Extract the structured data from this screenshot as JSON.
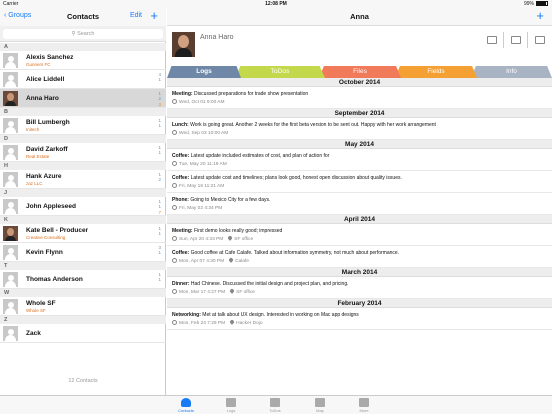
{
  "status": {
    "carrier": "Carrier",
    "time": "12:08 PM",
    "battery": "99%"
  },
  "left": {
    "back_label": "Groups",
    "title": "Contacts",
    "edit_label": "Edit",
    "add_label": "+",
    "search_placeholder": "Search",
    "footer": "12 Contacts",
    "sections": [
      {
        "letter": "A",
        "contacts": [
          {
            "name": "Alexis Sanchez",
            "company": "Gunners FC",
            "avatar": "generic",
            "counts": []
          },
          {
            "name": "Alice Liddell",
            "company": "",
            "avatar": "generic",
            "counts": [
              "4",
              "1"
            ]
          },
          {
            "name": "Anna Haro",
            "company": "",
            "avatar": "photo",
            "counts": [
              "1",
              "2",
              "3"
            ],
            "selected": true
          }
        ]
      },
      {
        "letter": "B",
        "contacts": [
          {
            "name": "Bill Lumbergh",
            "company": "Initech",
            "avatar": "generic",
            "counts": [
              "1",
              "1"
            ]
          }
        ]
      },
      {
        "letter": "D",
        "contacts": [
          {
            "name": "David Zarkoff",
            "company": "Real Estate",
            "avatar": "generic",
            "counts": [
              "1",
              "1"
            ]
          }
        ]
      },
      {
        "letter": "H",
        "contacts": [
          {
            "name": "Hank Azure",
            "company": "zaz LLC",
            "avatar": "generic",
            "counts": [
              "1",
              "2"
            ]
          }
        ]
      },
      {
        "letter": "J",
        "contacts": [
          {
            "name": "John Appleseed",
            "company": "",
            "avatar": "generic",
            "counts": [
              "1",
              "1",
              "7"
            ]
          }
        ]
      },
      {
        "letter": "K",
        "contacts": [
          {
            "name": "Kate Bell - Producer",
            "company": "Creative Consulting",
            "avatar": "photo",
            "counts": [
              "1",
              "1"
            ]
          },
          {
            "name": "Kevin Flynn",
            "company": "",
            "avatar": "generic",
            "counts": [
              "3",
              "1"
            ]
          }
        ]
      },
      {
        "letter": "T",
        "contacts": [
          {
            "name": "Thomas Anderson",
            "company": "",
            "avatar": "generic",
            "counts": [
              "1",
              "1"
            ]
          }
        ]
      },
      {
        "letter": "W",
        "contacts": [
          {
            "name": "Whole SF",
            "company": "Whole SF",
            "avatar": "generic",
            "counts": []
          }
        ]
      },
      {
        "letter": "Z",
        "contacts": [
          {
            "name": "Zack",
            "company": "",
            "avatar": "generic",
            "counts": []
          }
        ]
      }
    ]
  },
  "right": {
    "title": "Anna",
    "add_label": "+",
    "contact_name": "Anna Haro",
    "tabs": [
      "Logs",
      "ToDos",
      "Files",
      "Fields",
      "Info"
    ],
    "months": [
      {
        "label": "October 2014",
        "entries": [
          {
            "kind": "Meeting:",
            "text": "Discussed preparations for trade show presentation",
            "time": "Wed, Oct 01 9:00 AM",
            "place": ""
          }
        ]
      },
      {
        "label": "September 2014",
        "entries": [
          {
            "kind": "Lunch:",
            "text": "Work is going great. Another 2 weeks for the first beta version to be sent out. Happy with her work arrangement",
            "time": "Wed, Sep 03 10:00 AM",
            "place": ""
          }
        ]
      },
      {
        "label": "May 2014",
        "entries": [
          {
            "kind": "Coffee:",
            "text": "Latest update included estimates of cost, and plan of action for",
            "time": "Tue, May 20 11:19 AM",
            "place": ""
          },
          {
            "kind": "Coffee:",
            "text": "Latest update cost and timelines; plans look good, honest open discussion about quality issues.",
            "time": "Fri, May 16 11:21 AM",
            "place": ""
          },
          {
            "kind": "Phone:",
            "text": "Going to Mexico City for a few days.",
            "time": "Fri, May 02 4:34 PM",
            "place": ""
          }
        ]
      },
      {
        "label": "April 2014",
        "entries": [
          {
            "kind": "Meeting:",
            "text": "First demo looks really good; impressed",
            "time": "Sun, Apr 20 4:33 PM",
            "place": "SF office"
          },
          {
            "kind": "Coffee:",
            "text": "Good coffee at Cafe Calafe. Talked about information symmetry, not much about performance.",
            "time": "Mon, Apr 07 4:30 PM",
            "place": "Calafe"
          }
        ]
      },
      {
        "label": "March 2014",
        "entries": [
          {
            "kind": "Dinner:",
            "text": "Had Chinese. Discussed the initial design and project plan, and pricing.",
            "time": "Mon, Mar 17 4:27 PM",
            "place": "SF office"
          }
        ]
      },
      {
        "label": "February 2014",
        "entries": [
          {
            "kind": "Networking:",
            "text": "Met at talk about UX design. Interested in working on Mac app designs",
            "time": "Mon, Feb 24 7:29 PM",
            "place": "Hacker Dojo"
          }
        ]
      }
    ]
  },
  "tabbar": [
    "Contacts",
    "Logs",
    "ToDos",
    "Map",
    "More"
  ]
}
